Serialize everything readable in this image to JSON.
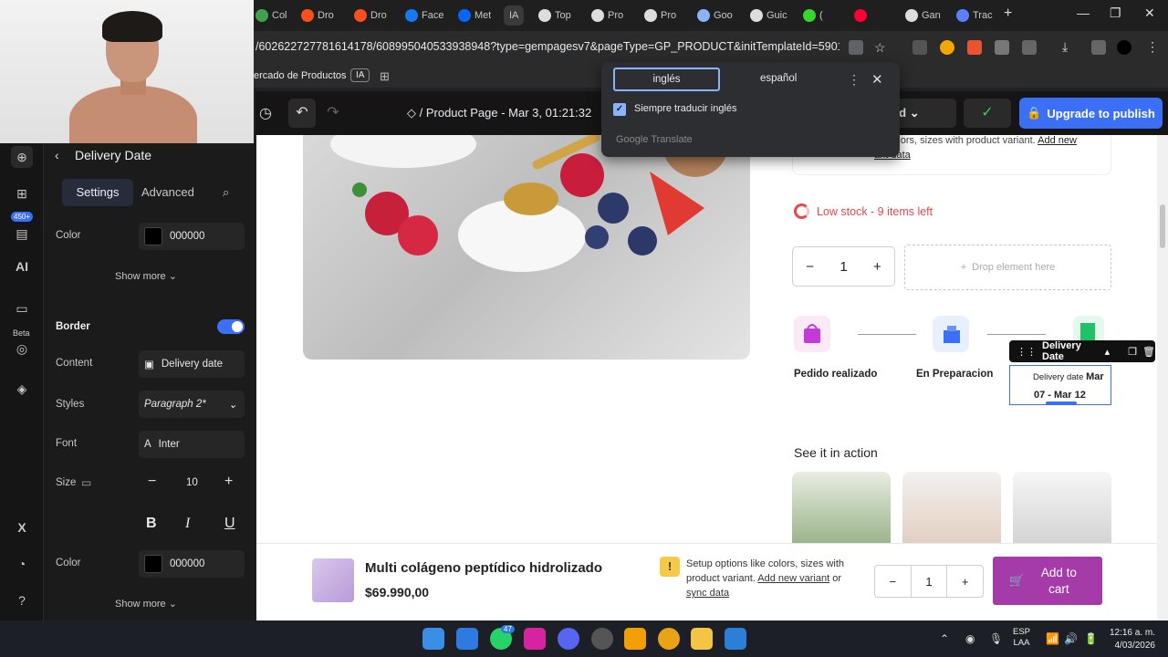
{
  "browser": {
    "tabs": [
      {
        "label": "Col",
        "color": "#3fa34d"
      },
      {
        "label": "Dro",
        "color": "#f4511e"
      },
      {
        "label": "Dro",
        "color": "#f4511e"
      },
      {
        "label": "Face",
        "color": "#1877f2"
      },
      {
        "label": "Met",
        "color": "#0866ff"
      },
      {
        "label": "IA",
        "color": "#777777"
      },
      {
        "label": "Top",
        "color": "#dddddd"
      },
      {
        "label": "Pro",
        "color": "#dddddd"
      },
      {
        "label": "Pro",
        "color": "#dddddd"
      },
      {
        "label": "Goo",
        "color": "#8ab4f8"
      },
      {
        "label": "Guic",
        "color": "#dddddd"
      },
      {
        "label": "(",
        "color": "#38d430"
      },
      {
        "label": "",
        "color": "#ff0033"
      },
      {
        "label": "Gan",
        "color": "#dddddd"
      },
      {
        "label": "Trac",
        "color": "#5b7fff"
      }
    ],
    "url": "/602622727781614178/608995040533938948?type=gempagesv7&pageType=GP_PRODUCT&initTemplateId=59018313100...",
    "bookmarks": {
      "market": "ercado de Productos",
      "ia": "IA"
    }
  },
  "translate": {
    "tab_source": "inglés",
    "tab_target": "español",
    "always_label": "Siempre traducir inglés",
    "brand": "Google Translate"
  },
  "editor": {
    "page_title": "/ Product Page - Mar 3, 01:21:32",
    "assigned": "gned",
    "upgrade": "Upgrade to publish"
  },
  "rail": {
    "badge": "450+",
    "beta": "Beta"
  },
  "panel": {
    "title": "Delivery Date",
    "tab_settings": "Settings",
    "tab_advanced": "Advanced",
    "color_label": "Color",
    "color_value": "000000",
    "show_more": "Show more",
    "border_label": "Border",
    "content_label": "Content",
    "content_value": "Delivery date",
    "styles_label": "Styles",
    "styles_value": "Paragraph 2*",
    "font_label": "Font",
    "font_value": "Inter",
    "font_letter": "A",
    "size_label": "Size",
    "size_value": "10",
    "color2_label": "Color",
    "color2_value": "000000",
    "show_more2": "Show more"
  },
  "canvas": {
    "variant_text": "ke colors, sizes with product variant.",
    "variant_link": "Add new",
    "variant_link2": "ant data",
    "low_stock": "Low stock - 9 items left",
    "qty": "1",
    "drop_here": "Drop element here",
    "step1": "Pedido realizado",
    "step2": "En Preparacion",
    "dd_toolbar": "Delivery Date",
    "dd_prefix": "Delivery date",
    "dd_month": "Mar",
    "dd_range": "07 - Mar 12",
    "see_action": "See it in action"
  },
  "sticky": {
    "name": "Multi colágeno peptídico hidrolizado",
    "price": "$69.990,00",
    "note_a": "Setup options like colors, sizes with product variant.",
    "note_link1": "Add new variant",
    "note_or": "or",
    "note_link2": "sync data",
    "qty": "1",
    "add_cart": "Add to cart"
  },
  "taskbar": {
    "lang1": "ESP",
    "lang2": "LAA",
    "time": "12:16 a. m.",
    "date": "4/03/2026",
    "badge": "47"
  }
}
